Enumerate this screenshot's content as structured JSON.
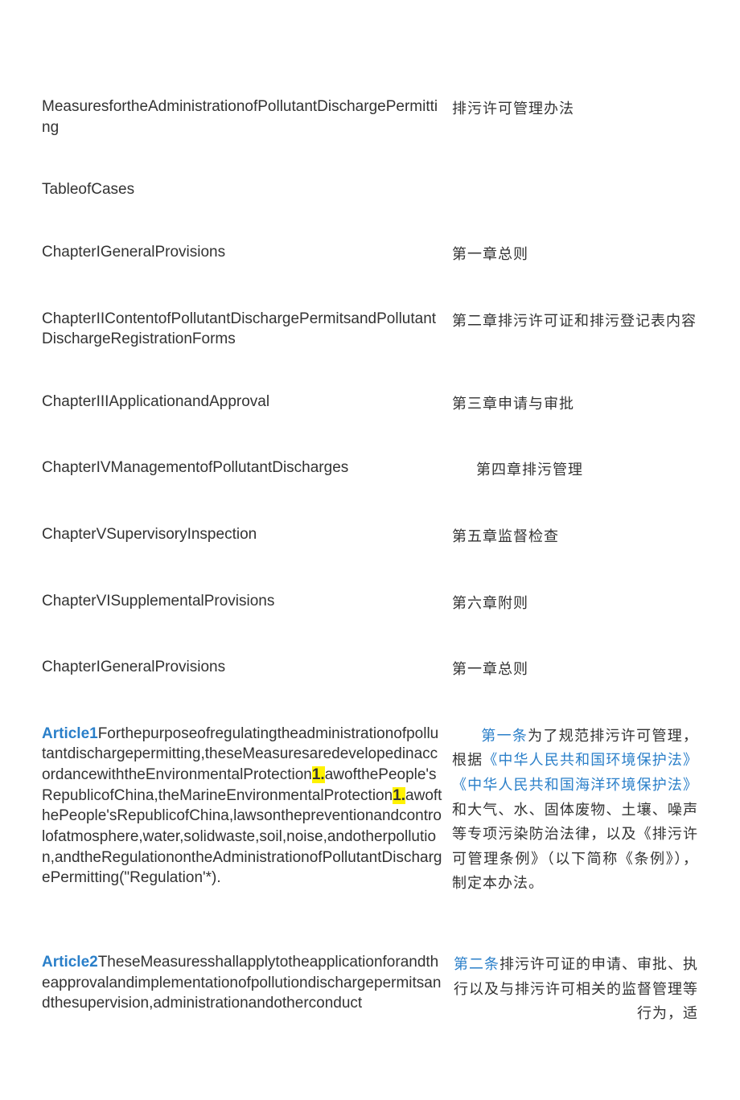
{
  "title": {
    "en": "MeasuresfortheAdministrationofPollutantDischargePermitting",
    "cn": "排污许可管理办法"
  },
  "toc_heading": "TableofCases",
  "chapters": [
    {
      "en": "ChapterIGeneralProvisions",
      "cn": "第一章总则"
    },
    {
      "en": "ChapterIIContentofPollutantDischargePermitsandPollutantDischargeRegistrationForms",
      "cn": "第二章排污许可证和排污登记表内容"
    },
    {
      "en": "ChapterIIIApplicationandApproval",
      "cn": "第三章申请与审批"
    },
    {
      "en": "ChapterIVManagementofPollutantDischarges",
      "cn": "第四章排污管理",
      "center": true
    },
    {
      "en": "ChapterVSupervisoryInspection",
      "cn": "第五章监督检查"
    },
    {
      "en": "ChapterVISupplementalProvisions",
      "cn": "第六章附则"
    },
    {
      "en": "ChapterIGeneralProvisions",
      "cn": "第一章总则"
    }
  ],
  "article1": {
    "label": "Article1",
    "en_before_hl1": "Forthepurposeofregulatingtheadministrationofpollutantdischargepermitting,theseMeasuresaredevelopedinaccordancewiththeEnvironmentalProtection",
    "hl1": "1.",
    "en_mid": "awofthePeople'sRepublicofChina,theMarineEnvironmentalProtection",
    "hl2": "1.",
    "en_after_hl2": "awofthePeople'sRepublicofChina,lawsonthepreventionandcontrolofatmosphere,water,solidwaste,soil,noise,andotherpollution,andtheRegulationontheAdministrationofPollutantDischargePermitting(\"Regulation'*).",
    "cn_art": "第一条",
    "cn_before_link": "为了规范排污许可管理，根据",
    "cn_link": "《中华人民共和国环境保护法》《中华人民共和国海洋环境保护法》",
    "cn_after_link": "和大气、水、固体废物、土壤、噪声等专项污染防治法律，以及《排污许可管理条例》（以下简称《条例》），制定本办法。"
  },
  "article2": {
    "label": "Article2",
    "en": "TheseMeasuresshallapplytotheapplicationforandtheapprovalandimplementationofpollutiondischargepermitsandthesupervision,administrationandotherconduct",
    "cn_art": "第二条",
    "cn": "排污许可证的申请、审批、执行以及与排污许可相关的监督管理等行为，适"
  }
}
